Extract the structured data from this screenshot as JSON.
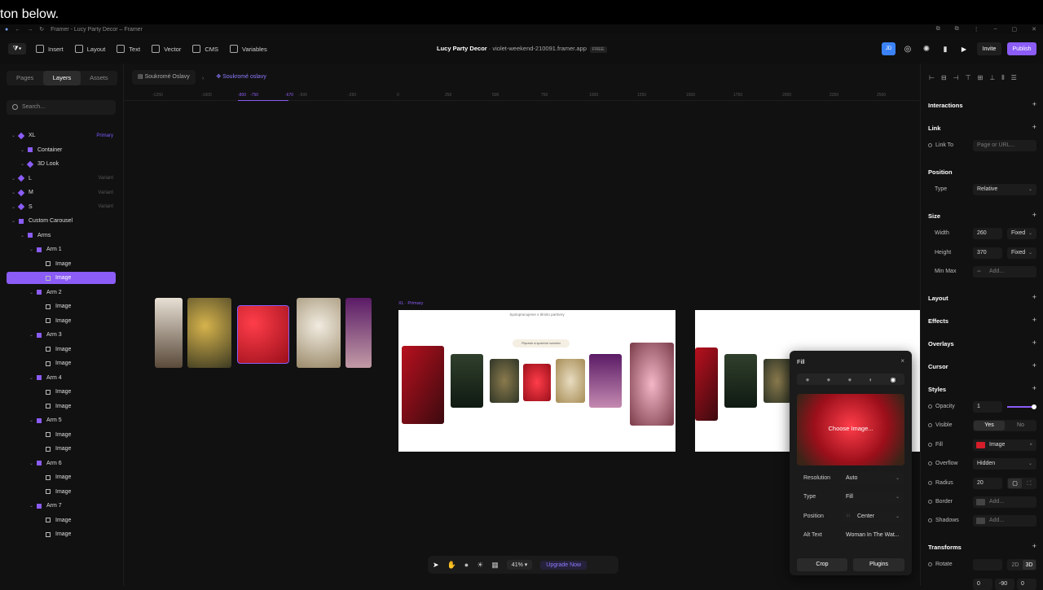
{
  "caption": "ton below.",
  "browser": {
    "tab_title": "Framer - Lucy Party Decor – Framer"
  },
  "toolbar": {
    "insert": "Insert",
    "layout": "Layout",
    "text": "Text",
    "vector": "Vector",
    "cms": "CMS",
    "variables": "Variables",
    "project_name": "Lucy Party Decor",
    "project_url": "· violet-weekend-210091.framer.app",
    "plan_badge": "FREE",
    "avatar": "JD",
    "invite": "Invite",
    "publish": "Publish"
  },
  "left_panel": {
    "tabs": [
      "Pages",
      "Layers",
      "Assets"
    ],
    "search_placeholder": "Search...",
    "layers": [
      {
        "label": "XL",
        "tag": "Primary",
        "indent": 0
      },
      {
        "label": "Container",
        "tag": "",
        "indent": 1
      },
      {
        "label": "3D Look",
        "tag": "",
        "indent": 1
      },
      {
        "label": "L",
        "tag": "Variant",
        "indent": 0
      },
      {
        "label": "M",
        "tag": "Variant",
        "indent": 0
      },
      {
        "label": "S",
        "tag": "Variant",
        "indent": 0
      },
      {
        "label": "Custom Carousel",
        "tag": "",
        "indent": 0
      },
      {
        "label": "Arms",
        "tag": "",
        "indent": 1
      },
      {
        "label": "Arm 1",
        "tag": "",
        "indent": 2
      },
      {
        "label": "Image",
        "tag": "",
        "indent": 3
      },
      {
        "label": "Image",
        "tag": "",
        "indent": 3,
        "selected": true
      },
      {
        "label": "Arm 2",
        "tag": "",
        "indent": 2
      },
      {
        "label": "Image",
        "tag": "",
        "indent": 3
      },
      {
        "label": "Image",
        "tag": "",
        "indent": 3
      },
      {
        "label": "Arm 3",
        "tag": "",
        "indent": 2
      },
      {
        "label": "Image",
        "tag": "",
        "indent": 3
      },
      {
        "label": "Image",
        "tag": "",
        "indent": 3
      },
      {
        "label": "Arm 4",
        "tag": "",
        "indent": 2
      },
      {
        "label": "Image",
        "tag": "",
        "indent": 3
      },
      {
        "label": "Image",
        "tag": "",
        "indent": 3
      },
      {
        "label": "Arm 5",
        "tag": "",
        "indent": 2
      },
      {
        "label": "Image",
        "tag": "",
        "indent": 3
      },
      {
        "label": "Image",
        "tag": "",
        "indent": 3
      },
      {
        "label": "Arm 6",
        "tag": "",
        "indent": 2
      },
      {
        "label": "Image",
        "tag": "",
        "indent": 3
      },
      {
        "label": "Image",
        "tag": "",
        "indent": 3
      },
      {
        "label": "Arm 7",
        "tag": "",
        "indent": 2
      },
      {
        "label": "Image",
        "tag": "",
        "indent": 3
      },
      {
        "label": "Image",
        "tag": "",
        "indent": 3
      }
    ]
  },
  "canvas": {
    "breadcrumb_page": "Soukromé Oslavy",
    "breadcrumb_current": "Soukromé oslavy",
    "ruler_labels": [
      "-1250",
      "-1000",
      "-800",
      "-750",
      "-670",
      "-500",
      "-250",
      "0",
      "250",
      "500",
      "750",
      "1000",
      "1250",
      "1500",
      "1750",
      "2000",
      "2250",
      "2500"
    ],
    "frame_label": "XL · Primary",
    "frame_header": "Spolupracujeme s těmito partnery",
    "frame_cta": "Připravte si společné rozvlnění"
  },
  "bottom_bar": {
    "zoom": "41%",
    "upgrade": "Upgrade Now"
  },
  "fill_popover": {
    "title": "Fill",
    "choose": "Choose Image...",
    "rows": [
      {
        "label": "Resolution",
        "value": "Auto"
      },
      {
        "label": "Type",
        "value": "Fill"
      },
      {
        "label": "Position",
        "value": "Center"
      },
      {
        "label": "Alt Text",
        "value": "Woman In The Wat..."
      }
    ],
    "crop": "Crop",
    "plugins": "Plugins"
  },
  "right_panel": {
    "interactions": "Interactions",
    "link": "Link",
    "link_to": "Link To",
    "link_placeholder": "Page or URL...",
    "position": "Position",
    "type_label": "Type",
    "type_value": "Relative",
    "size": "Size",
    "width_label": "Width",
    "width": "260",
    "width_mode": "Fixed",
    "height_label": "Height",
    "height": "370",
    "height_mode": "Fixed",
    "minmax": "Min Max",
    "add": "Add...",
    "layout": "Layout",
    "effects": "Effects",
    "overlays": "Overlays",
    "cursor": "Cursor",
    "styles": "Styles",
    "opacity_label": "Opacity",
    "opacity": "1",
    "visible_label": "Visible",
    "yes": "Yes",
    "no": "No",
    "fill_label": "Fill",
    "fill_value": "Image",
    "overflow_label": "Overflow",
    "overflow_value": "Hidden",
    "radius_label": "Radius",
    "radius": "20",
    "border_label": "Border",
    "shadows_label": "Shadows",
    "transforms": "Transforms",
    "rotate_label": "Rotate",
    "mode_2d": "2D",
    "mode_3d": "3D",
    "rot_x": "0",
    "rot_y": "-90",
    "rot_z": "0"
  },
  "colors": {
    "accent": "#8b5cf6",
    "publish": "#8b5cf6",
    "avatar": "#3b82f6"
  }
}
